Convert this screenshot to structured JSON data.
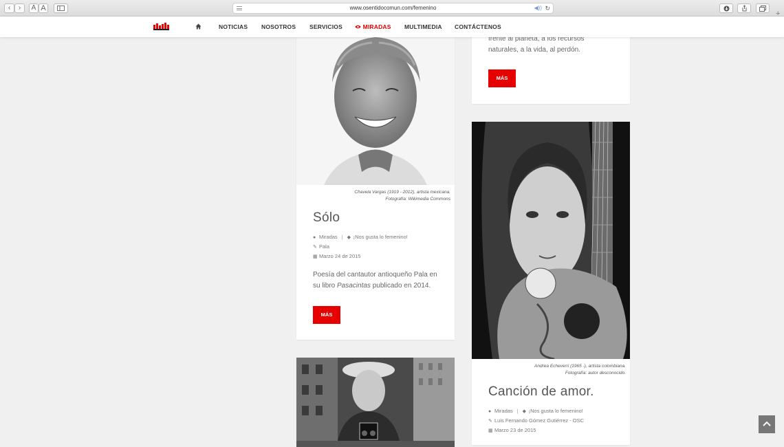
{
  "browser": {
    "url": "www.osentidocomun.com/femenino",
    "font_small": "A",
    "font_large": "A"
  },
  "nav": {
    "items": [
      {
        "label": "NOTICIAS"
      },
      {
        "label": "NOSOTROS"
      },
      {
        "label": "SERVICIOS"
      },
      {
        "label": "MIRADAS"
      },
      {
        "label": "MULTIMEDIA"
      },
      {
        "label": "CONTÁCTENOS"
      }
    ],
    "active_color": "#e60000"
  },
  "top_right_card": {
    "excerpt_line1": "frente al planeta, a los recursos",
    "excerpt_line2": "naturales, a la vida, al perdón.",
    "button": "MÁS"
  },
  "card_solo": {
    "caption_line1": "Chavela Vargas (1919 - 2012), artista mexicana.",
    "caption_line2": "Fotografía: Wikimedia Commons",
    "title": "Sólo",
    "category": "Miradas",
    "tag": "¡Nos gusta lo femenino!",
    "author": "Pala",
    "date": "Marzo 24 de 2015",
    "excerpt_a": "Poesía del cantautor antioqueño Pala en",
    "excerpt_b": "su libro ",
    "excerpt_em": "Pasacintas",
    "excerpt_c": " publicado en 2014.",
    "button": "MÁS"
  },
  "card_cancion": {
    "caption_line1": "Andrea Echeverri (1965 -), artista colombiana.",
    "caption_line2": "Fotografía: autor desconocido.",
    "title": "Canción de amor.",
    "category": "Miradas",
    "tag": "¡Nos gusta lo femenino!",
    "author": "Luis Fernando Gómez Gutiérrez - OSC",
    "date": "Marzo 23 de 2015"
  },
  "colors": {
    "accent": "#e60000",
    "page_bg": "#f0f0f0"
  }
}
